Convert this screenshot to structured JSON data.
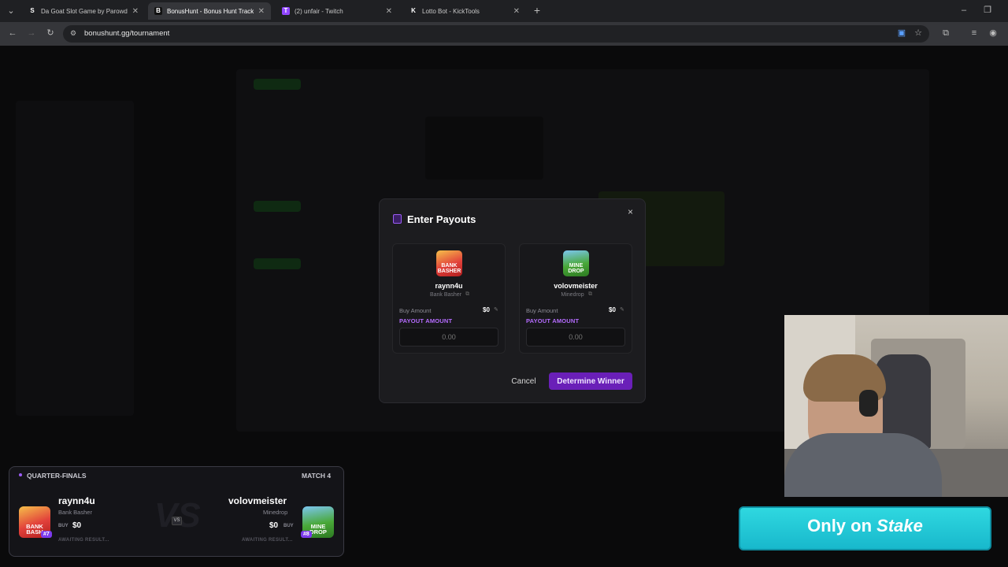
{
  "browser": {
    "tabs": [
      {
        "title": "Da Goat Slot Game by Parowde",
        "icon": "S",
        "active": false
      },
      {
        "title": "BonusHunt - Bonus Hunt Tracke",
        "icon": "B",
        "active": true
      },
      {
        "title": "(2) unfair - Twitch",
        "icon": "T",
        "active": false
      },
      {
        "title": "Lotto Bot - KickTools",
        "icon": "K",
        "active": false
      }
    ],
    "new_tab": "+",
    "url": "bonushunt.gg/tournament"
  },
  "modal": {
    "title": "Enter Payouts",
    "close": "×",
    "players": [
      {
        "name": "raynn4u",
        "game": "Bank Basher",
        "thumb_text": "BANK BASHER",
        "buy_label": "Buy Amount",
        "buy_value": "$0",
        "payout_label": "PAYOUT AMOUNT",
        "payout_placeholder": "0.00"
      },
      {
        "name": "volovmeister",
        "game": "Minedrop",
        "thumb_text": "MINE DROP",
        "buy_label": "Buy Amount",
        "buy_value": "$0",
        "payout_label": "PAYOUT AMOUNT",
        "payout_placeholder": "0.00"
      }
    ],
    "cancel": "Cancel",
    "determine": "Determine Winner"
  },
  "match": {
    "stage": "QUARTER-FINALS",
    "number": "MATCH 4",
    "vs": "VS",
    "left": {
      "name": "raynn4u",
      "game": "Bank Basher",
      "buy_label": "BUY",
      "buy_value": "$0",
      "status": "AWAITING RESULT...",
      "seed": "#7",
      "thumb_text": "BANK BASH"
    },
    "right": {
      "name": "volovmeister",
      "game": "Minedrop",
      "buy_label": "BUY",
      "buy_value": "$0",
      "status": "AWAITING RESULT...",
      "seed": "#8",
      "thumb_text": "MINE DROP"
    }
  },
  "banner": {
    "prefix": "Only on ",
    "brand": "Stake"
  },
  "colors": {
    "accent": "#7c3aed",
    "payout_label": "#b56cff",
    "banner": "#2fd8e0"
  }
}
